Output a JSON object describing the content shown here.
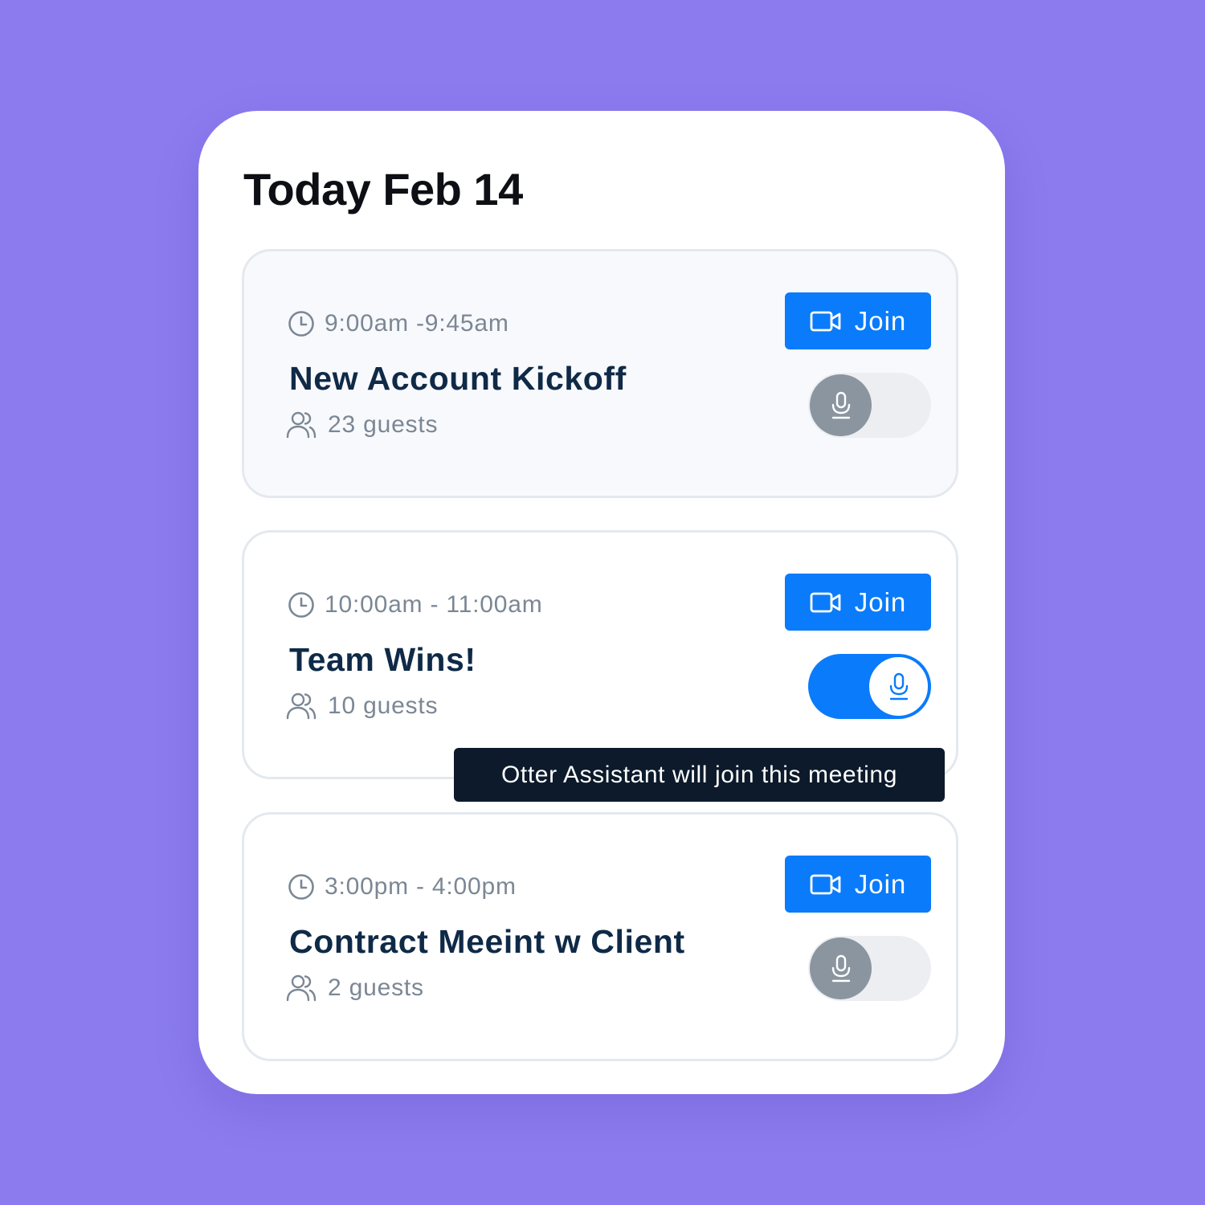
{
  "header": {
    "title": "Today Feb 14"
  },
  "colors": {
    "background": "#8b7bef",
    "accent": "#0a7bfa",
    "title_text": "#0f2a47",
    "muted_text": "#7b8794",
    "tooltip_bg": "#0c1a2b",
    "toggle_off_knob": "#8b959f"
  },
  "icons": {
    "time": "clock-icon",
    "guests": "people-icon",
    "join": "video-camera-icon",
    "toggle": "microphone-icon"
  },
  "meetings": [
    {
      "time": "9:00am -9:45am",
      "title": "New Account Kickoff",
      "guests": "23 guests",
      "join_label": "Join",
      "assistant_enabled": false
    },
    {
      "time": "10:00am - 11:00am",
      "title": "Team Wins!",
      "guests": "10 guests",
      "join_label": "Join",
      "assistant_enabled": true
    },
    {
      "time": "3:00pm - 4:00pm",
      "title": "Contract Meeint w Client",
      "guests": "2 guests",
      "join_label": "Join",
      "assistant_enabled": false
    }
  ],
  "tooltip": {
    "text": "Otter Assistant will join this meeting"
  }
}
